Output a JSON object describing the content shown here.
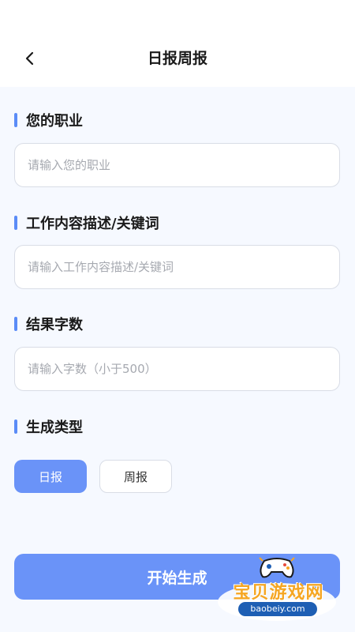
{
  "header": {
    "title": "日报周报",
    "back_icon": "chevron-left-icon"
  },
  "form": {
    "occupation": {
      "label": "您的职业",
      "placeholder": "请输入您的职业",
      "value": ""
    },
    "description": {
      "label": "工作内容描述/关键词",
      "placeholder": "请输入工作内容描述/关键词",
      "value": ""
    },
    "word_count": {
      "label": "结果字数",
      "placeholder": "请输入字数（小于500）",
      "value": ""
    },
    "type": {
      "label": "生成类型",
      "options": [
        "日报",
        "周报"
      ],
      "selected": "日报"
    }
  },
  "submit_label": "开始生成",
  "colors": {
    "accent": "#6a93f8",
    "bar": "#5b8cf7",
    "background": "#f6f9ff"
  },
  "watermark": {
    "text": "宝贝游戏网",
    "url": "baobeiy.com"
  }
}
